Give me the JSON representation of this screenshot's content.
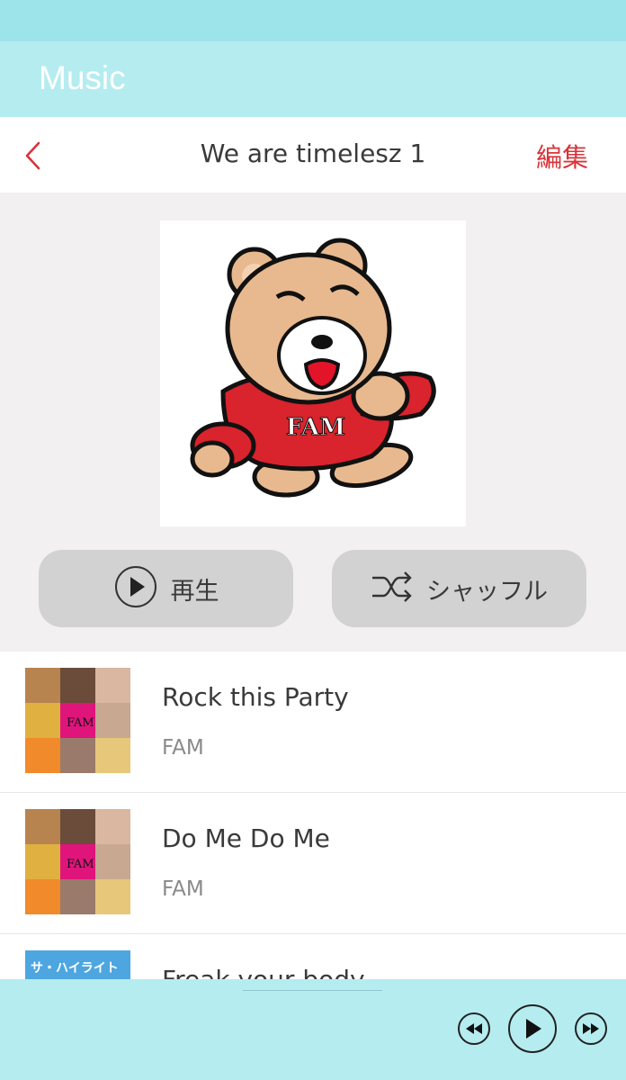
{
  "app": {
    "title": "Music"
  },
  "nav": {
    "back_icon": "chevron-left-icon",
    "title": "We are timelesz 1",
    "edit_label": "編集",
    "accent": "#d8343a"
  },
  "actions": {
    "play_label": "再生",
    "shuffle_label": "シャッフル"
  },
  "album_art": {
    "text": "FAM"
  },
  "tracks": [
    {
      "title": "Rock this Party",
      "artist": "FAM",
      "thumb_text": "FAM"
    },
    {
      "title": "Do Me Do Me",
      "artist": "FAM",
      "thumb_text": "FAM"
    },
    {
      "title": "Freak your body",
      "artist": "",
      "thumb_text": "サ・ハイライト"
    }
  ],
  "player": {
    "rewind_icon": "rewind-icon",
    "play_icon": "play-icon",
    "forward_icon": "fast-forward-icon"
  },
  "colors": {
    "statusbar": "#9de4ea",
    "appbar": "#b5ecf0",
    "hero_bg": "#f2f0f1",
    "button_bg": "#d2d2d2"
  }
}
